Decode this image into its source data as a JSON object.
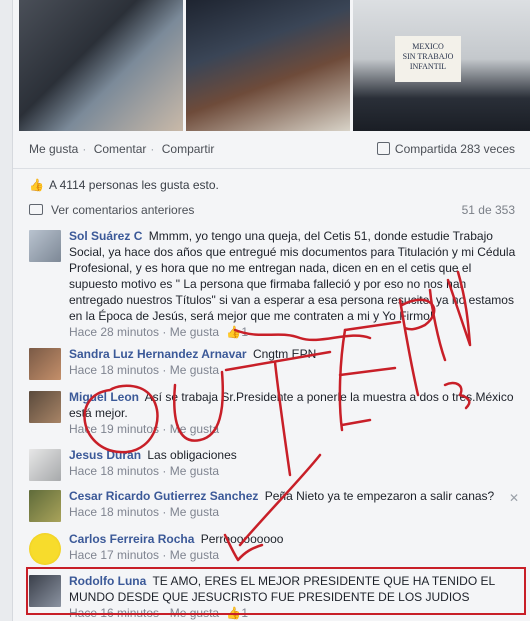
{
  "photos": {
    "sign_text": "MEXICO\nSIN TRABAJO\nINFANTIL"
  },
  "post_actions": {
    "like": "Me gusta",
    "comment": "Comentar",
    "share": "Compartir",
    "shared_count": "Compartida 283 veces"
  },
  "likes_summary": "A 4114 personas les gusta esto.",
  "view_previous": "Ver comentarios anteriores",
  "comment_count": "51 de 353",
  "comments": [
    {
      "name": "Sol Suárez C",
      "text": "Mmmm, yo tengo una queja, del Cetis 51, donde estudie Trabajo Social, ya hace dos años que entregué mis documentos para Titulación y mi Cédula Profesional, y es hora que no me entregan nada, dicen en en el cetis que el supuesto motivo es \" La persona que firmaba falleció y por eso no nos han entregado nuestros Títulos\" si van a esperar a esa persona resucite, ya no estamos en la Época de Jesús, será mejor que me contraten a mi y Yo Firmo!",
      "time": "Hace 28 minutos",
      "like": "Me gusta",
      "likes": "1"
    },
    {
      "name": "Sandra Luz Hernandez Arnavar",
      "text": "Cngtm EPN",
      "time": "Hace 18 minutos",
      "like": "Me gusta"
    },
    {
      "name": "Miguel Leon",
      "text": "Así se trabaja Sr.Presidente a ponerle la muestra a dos o tres.México está mejor.",
      "time": "Hace 19 minutos",
      "like": "Me gusta"
    },
    {
      "name": "Jesus Duran",
      "text": "Las obligaciones",
      "time": "Hace 18 minutos",
      "like": "Me gusta"
    },
    {
      "name": "Cesar Ricardo Gutierrez Sanchez",
      "text": "Peña Nieto ya te empezaron a salir canas?",
      "time": "Hace 18 minutos",
      "like": "Me gusta"
    },
    {
      "name": "Carlos Ferreira Rocha",
      "text": "Perrooooooooo",
      "time": "Hace 17 minutos",
      "like": "Me gusta"
    },
    {
      "name": "Rodolfo Luna",
      "text": "TE AMO, ERES EL MEJOR PRESIDENTE QUE HA TENIDO EL MUNDO DESDE QUE JESUCRISTO FUE PRESIDENTE DE LOS JUDIOS",
      "time": "Hace 16 minutos",
      "like": "Me gusta",
      "likes": "1"
    }
  ],
  "annotation": {
    "scrawl_text": "OUT EPN",
    "color": "#c81f28"
  },
  "colors": {
    "link": "#3b5998",
    "meta": "#7f8490",
    "annotation": "#c81f28"
  }
}
